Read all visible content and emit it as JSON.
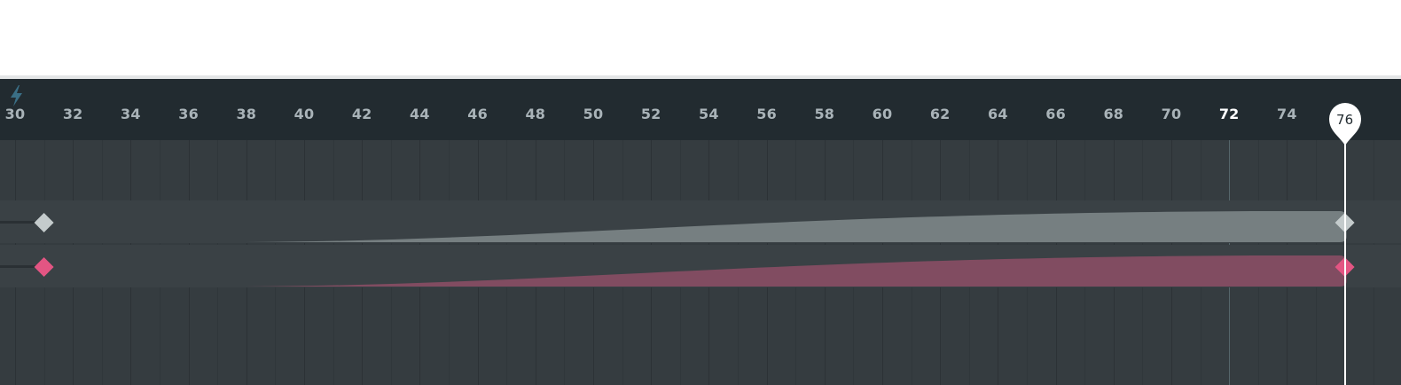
{
  "ruler": {
    "ticks": [
      "30",
      "32",
      "34",
      "36",
      "38",
      "40",
      "42",
      "44",
      "46",
      "48",
      "50",
      "52",
      "54",
      "56",
      "58",
      "60",
      "62",
      "64",
      "66",
      "68",
      "70",
      "72",
      "74"
    ],
    "current_tick": "72",
    "snap_icon": "lightning-bolt-icon"
  },
  "playhead": {
    "label": "76",
    "frame": 76
  },
  "tracks": [
    {
      "name": "",
      "color": "#c4cbcc",
      "fill_color": "#767f81",
      "keyframes": [
        {
          "frame": 31,
          "shape": "diamond"
        },
        {
          "frame": 76,
          "shape": "diamond"
        }
      ],
      "easing": "ease-in"
    },
    {
      "name": "",
      "color": "#e35583",
      "fill_color": "#814c61",
      "keyframes": [
        {
          "frame": 31,
          "shape": "diamond"
        },
        {
          "frame": 76,
          "shape": "diamond"
        }
      ],
      "easing": "ease-in"
    }
  ],
  "colors": {
    "ruler_bg": "#222b30",
    "timeline_bg": "#353c40",
    "tick_text": "#a9b3b8",
    "accent_icon": "#3a6f86",
    "playhead": "#ffffff"
  }
}
